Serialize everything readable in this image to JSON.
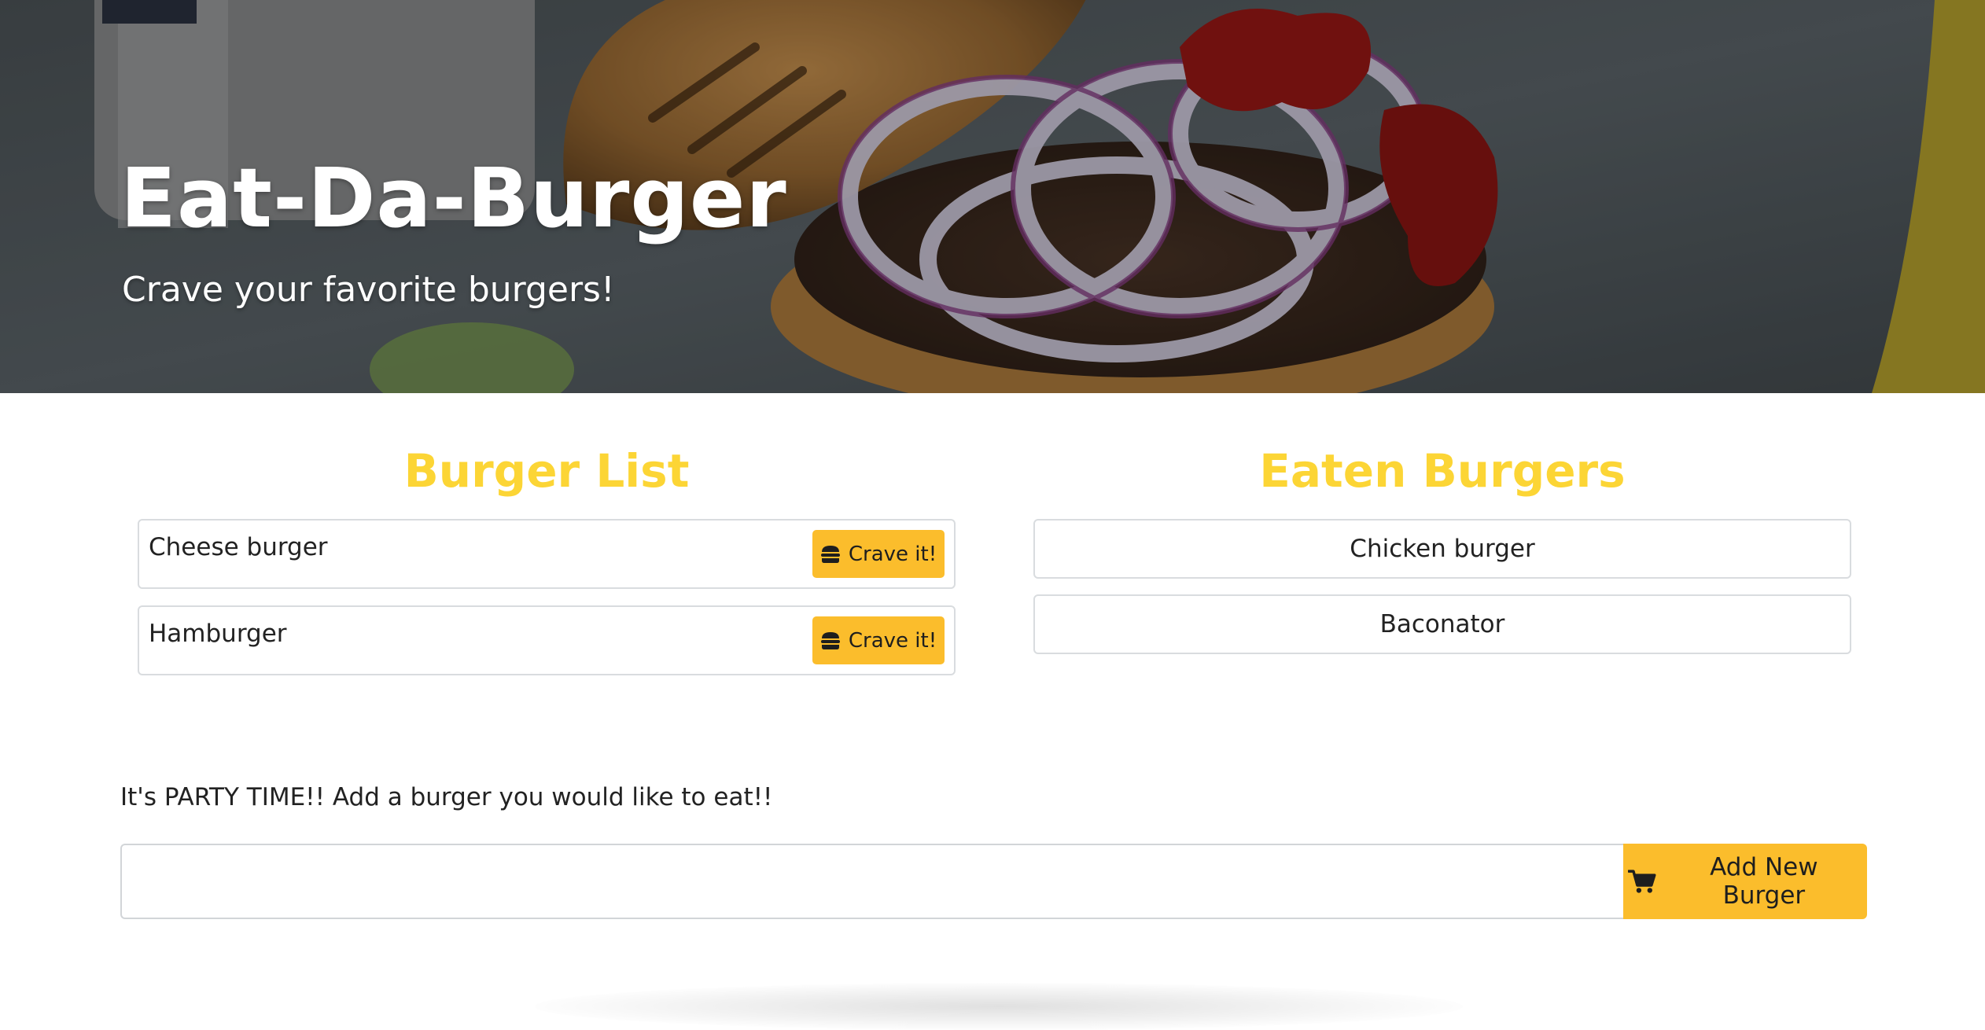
{
  "hero": {
    "title": "Eat-Da-Burger",
    "subtitle": "Crave your favorite burgers!"
  },
  "burger_list": {
    "heading": "Burger List",
    "items": [
      {
        "name": "Cheese burger",
        "button_label": "Crave it!"
      },
      {
        "name": "Hamburger",
        "button_label": "Crave it!"
      }
    ],
    "button_icon": "hamburger-icon"
  },
  "eaten_burgers": {
    "heading": "Eaten Burgers",
    "items": [
      {
        "name": "Chicken burger"
      },
      {
        "name": "Baconator"
      }
    ]
  },
  "add_form": {
    "prompt": "It's PARTY TIME!! Add a burger you would like to eat!!",
    "input_value": "",
    "button_label": "Add New Burger",
    "button_icon": "shopping-cart-icon"
  },
  "colors": {
    "accent_heading": "#fcd535",
    "button": "#fbbd2c",
    "text": "#222222"
  }
}
